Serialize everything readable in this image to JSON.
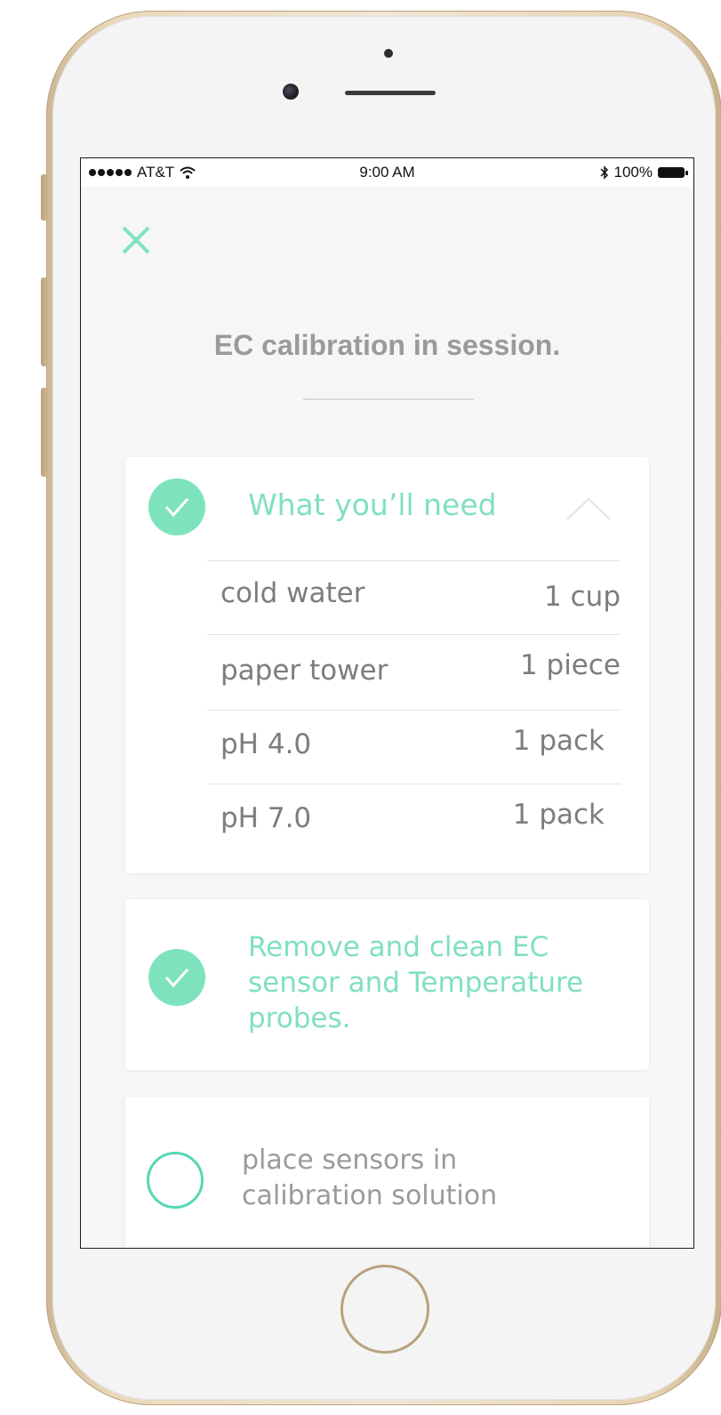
{
  "status_bar": {
    "carrier": "AT&T",
    "time": "9:00 AM",
    "battery": "100%",
    "icons": [
      "signal-dots-icon",
      "wifi-icon",
      "bluetooth-icon",
      "battery-icon"
    ]
  },
  "header": {
    "close_icon": "close-icon",
    "title": "EC calibration in session."
  },
  "supplies_card": {
    "heading": "What you’ll need",
    "completed": true,
    "expanded": true,
    "items": [
      {
        "name": "cold water",
        "qty": "1 cup"
      },
      {
        "name": "paper tower",
        "qty": "1 piece"
      },
      {
        "name": "pH 4.0",
        "qty": "1 pack"
      },
      {
        "name": "pH 7.0",
        "qty": "1 pack"
      }
    ]
  },
  "steps": [
    {
      "line1": "Remove and clean EC",
      "line2": "sensor and Temperature",
      "line3": "probes.",
      "completed": true
    },
    {
      "line1": "place sensors in",
      "line2": "calibration solution",
      "completed": false
    }
  ],
  "colors": {
    "accent": "#7ee3bd",
    "accent_text": "#7fe0bf",
    "ring": "#55d8b4",
    "title_gray": "#9a9a9a",
    "text_gray": "#7d7d7d",
    "background": "#f6f6f6",
    "phone_gold": "#e6d4b6"
  }
}
